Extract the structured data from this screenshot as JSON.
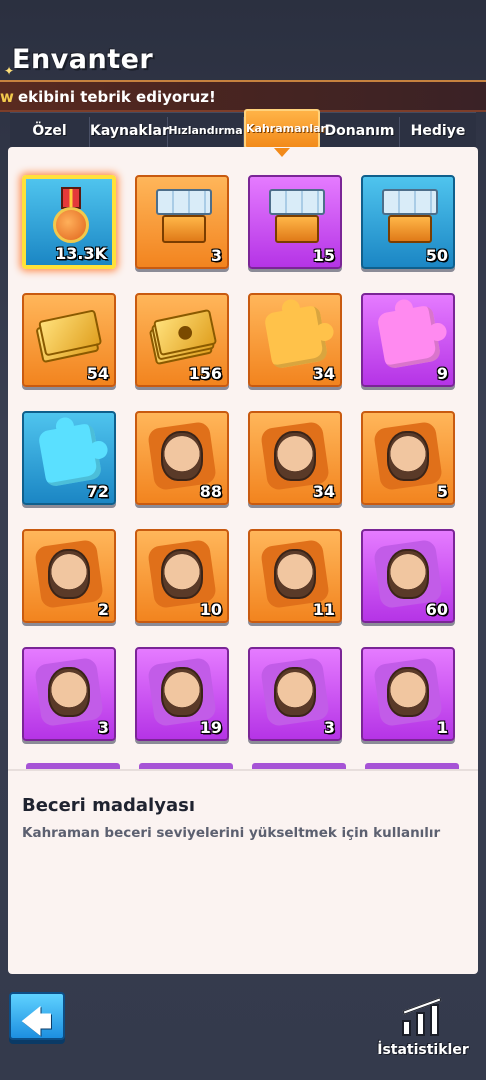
{
  "header": {
    "title": "Envanter",
    "banner_prefix": "w",
    "banner_text": "ekibini tebrik ediyoruz!"
  },
  "tabs": [
    {
      "label": "Özel",
      "active": false
    },
    {
      "label": "Kaynaklar",
      "active": false
    },
    {
      "label": "Hızlandırma",
      "active": false
    },
    {
      "label": "Kahramanlar",
      "active": true
    },
    {
      "label": "Donanım",
      "active": false
    },
    {
      "label": "Hediye",
      "active": false
    }
  ],
  "items": [
    {
      "icon": "medal-icon",
      "rarity": "blue",
      "count": "13.3K",
      "selected": true
    },
    {
      "icon": "exp-chest-icon",
      "rarity": "orange",
      "count": "3"
    },
    {
      "icon": "exp-chest-icon",
      "rarity": "purple",
      "count": "15"
    },
    {
      "icon": "exp-chest-icon",
      "rarity": "blue",
      "count": "50"
    },
    {
      "icon": "gold-card-icon",
      "rarity": "orange",
      "count": "54"
    },
    {
      "icon": "paw-card-icon",
      "rarity": "orange",
      "count": "156"
    },
    {
      "icon": "puzzle-piece-icon",
      "rarity": "orange",
      "count": "34"
    },
    {
      "icon": "puzzle-piece-icon",
      "rarity": "purple",
      "count": "9"
    },
    {
      "icon": "puzzle-piece-icon",
      "rarity": "blue",
      "count": "72"
    },
    {
      "icon": "hero-shard-icon",
      "rarity": "orange",
      "count": "88"
    },
    {
      "icon": "hero-shard-icon",
      "rarity": "orange",
      "count": "34"
    },
    {
      "icon": "hero-shard-icon",
      "rarity": "orange",
      "count": "5"
    },
    {
      "icon": "hero-shard-icon",
      "rarity": "orange",
      "count": "2"
    },
    {
      "icon": "hero-shard-icon",
      "rarity": "orange",
      "count": "10"
    },
    {
      "icon": "hero-shard-icon",
      "rarity": "orange",
      "count": "11"
    },
    {
      "icon": "hero-shard-icon",
      "rarity": "purple",
      "count": "60"
    },
    {
      "icon": "hero-shard-icon",
      "rarity": "purple",
      "count": "3"
    },
    {
      "icon": "hero-shard-icon",
      "rarity": "purple",
      "count": "19"
    },
    {
      "icon": "hero-shard-icon",
      "rarity": "purple",
      "count": "3"
    },
    {
      "icon": "hero-shard-icon",
      "rarity": "purple",
      "count": "1"
    }
  ],
  "detail": {
    "title": "Beceri madalyası",
    "description": "Kahraman beceri seviyelerini yükseltmek için kullanılır"
  },
  "footer": {
    "back_icon": "back-arrow-icon",
    "stats_label": "İstatistikler"
  },
  "colors": {
    "orange": "#f2841f",
    "purple": "#b534e6",
    "blue": "#1b86c4",
    "selected_border": "#ffe13a",
    "active_tab": "#f28a1a"
  }
}
